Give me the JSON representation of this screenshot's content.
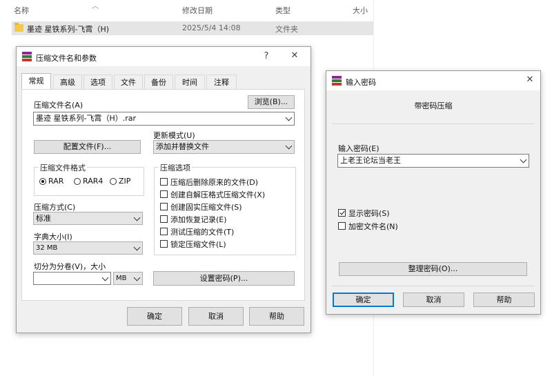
{
  "explorer": {
    "columns": {
      "name": "名称",
      "modified": "修改日期",
      "type": "类型",
      "size": "大小"
    },
    "rows": [
      {
        "name": "墨迹 星铁系列-飞霄（H)",
        "modified": "2025/5/4 14:08",
        "type": "文件夹"
      }
    ]
  },
  "archive_dialog": {
    "title": "压缩文件名和参数",
    "help_label": "?",
    "close_label": "✕",
    "tabs": [
      "常规",
      "高级",
      "选项",
      "文件",
      "备份",
      "时间",
      "注释"
    ],
    "archive_name_label": "压缩文件名(A)",
    "browse_label": "浏览(B)...",
    "archive_name_value": "墨迹 星铁系列-飞霄（H）.rar",
    "update_mode_label": "更新模式(U)",
    "update_mode_value": "添加并替换文件",
    "profiles_label": "配置文件(F)...",
    "format_group_title": "压缩文件格式",
    "formats": [
      "RAR",
      "RAR4",
      "ZIP"
    ],
    "selected_format": "RAR",
    "options_group_title": "压缩选项",
    "options": [
      "压缩后删除原来的文件(D)",
      "创建自解压格式压缩文件(X)",
      "创建固实压缩文件(S)",
      "添加恢复记录(E)",
      "测试压缩的文件(T)",
      "锁定压缩文件(L)"
    ],
    "method_label": "压缩方式(C)",
    "method_value": "标准",
    "dict_label": "字典大小(I)",
    "dict_value": "32 MB",
    "split_label": "切分为分卷(V)，大小",
    "split_value": "",
    "split_unit": "MB",
    "set_password_label": "设置密码(P)...",
    "ok_label": "确定",
    "cancel_label": "取消",
    "help_button_label": "帮助"
  },
  "password_dialog": {
    "title": "输入密码",
    "close_label": "✕",
    "heading": "带密码压缩",
    "password_label": "输入密码(E)",
    "password_value": "上老王论坛当老王",
    "show_password_label": "显示密码(S)",
    "show_password_checked": true,
    "encrypt_names_label": "加密文件名(N)",
    "encrypt_names_checked": false,
    "organize_label": "整理密码(O)...",
    "ok_label": "确定",
    "cancel_label": "取消",
    "help_label": "帮助"
  },
  "colors": {
    "accent": "#0078d7",
    "dialog_bg": "#f0f0f0",
    "selected_row": "#e5e5e5",
    "folder": "#f2c94c"
  }
}
